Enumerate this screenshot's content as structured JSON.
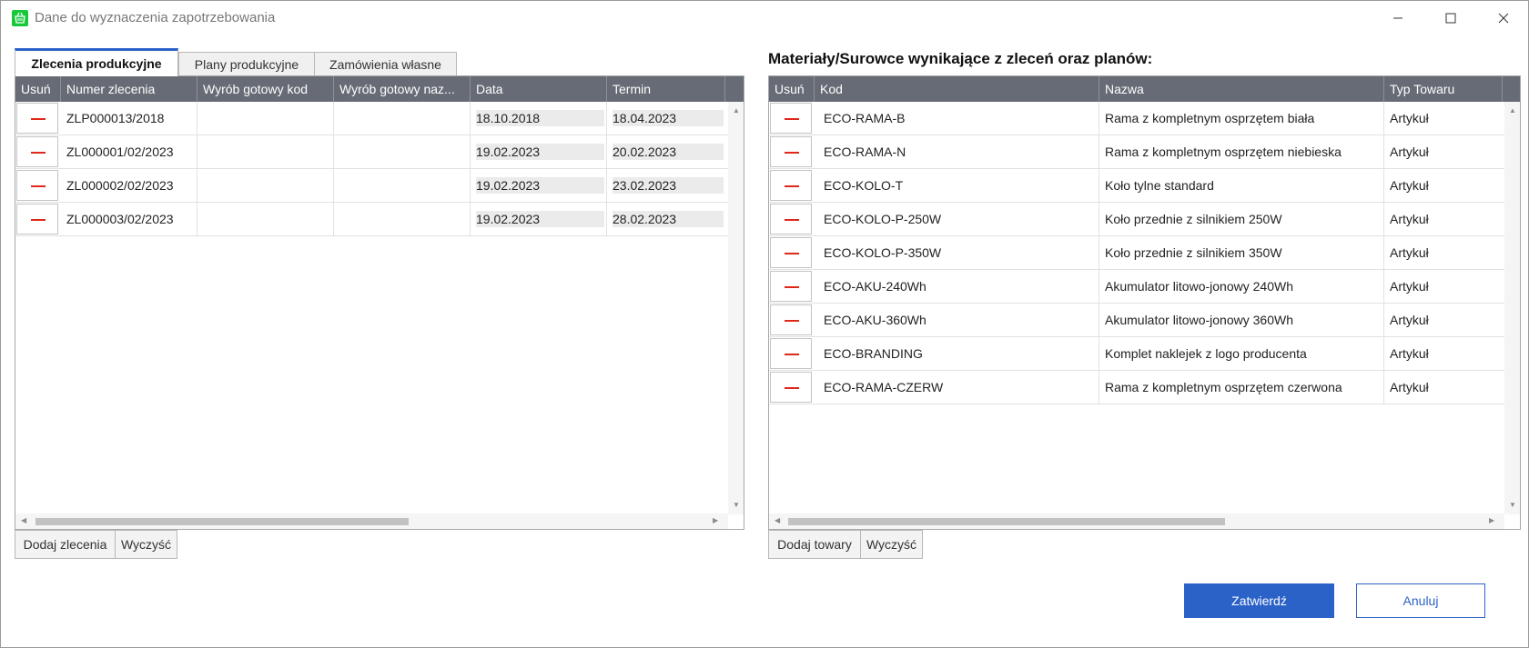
{
  "window": {
    "title": "Dane do wyznaczenia zapotrzebowania",
    "icon": "basket-icon",
    "controls": [
      "minimize-icon",
      "maximize-icon",
      "close-icon"
    ]
  },
  "left": {
    "tabs": [
      {
        "label": "Zlecenia produkcyjne",
        "active": true
      },
      {
        "label": "Plany produkcyjne",
        "active": false
      },
      {
        "label": "Zamówienia własne",
        "active": false
      }
    ],
    "columns": [
      "Usuń",
      "Numer zlecenia",
      "Wyrób gotowy kod",
      "Wyrób gotowy naz...",
      "Data",
      "Termin"
    ],
    "rows": [
      {
        "numer": "ZLP000013/2018",
        "kod": "",
        "nazwa": "",
        "data": "18.10.2018",
        "termin": "18.04.2023"
      },
      {
        "numer": "ZL000001/02/2023",
        "kod": "",
        "nazwa": "",
        "data": "19.02.2023",
        "termin": "20.02.2023"
      },
      {
        "numer": "ZL000002/02/2023",
        "kod": "",
        "nazwa": "",
        "data": "19.02.2023",
        "termin": "23.02.2023"
      },
      {
        "numer": "ZL000003/02/2023",
        "kod": "",
        "nazwa": "",
        "data": "19.02.2023",
        "termin": "28.02.2023"
      }
    ],
    "add_button": "Dodaj zlecenia",
    "clear_button": "Wyczyść"
  },
  "right": {
    "title": "Materiały/Surowce wynikające z zleceń oraz planów:",
    "columns": [
      "Usuń",
      "Kod",
      "Nazwa",
      "Typ Towaru"
    ],
    "rows": [
      {
        "kod": "ECO-RAMA-B",
        "nazwa": "Rama z kompletnym osprzętem biała",
        "typ": "Artykuł"
      },
      {
        "kod": "ECO-RAMA-N",
        "nazwa": "Rama z kompletnym osprzętem niebieska",
        "typ": "Artykuł"
      },
      {
        "kod": "ECO-KOLO-T",
        "nazwa": "Koło tylne standard",
        "typ": "Artykuł"
      },
      {
        "kod": "ECO-KOLO-P-250W",
        "nazwa": "Koło przednie z silnikiem 250W",
        "typ": "Artykuł"
      },
      {
        "kod": "ECO-KOLO-P-350W",
        "nazwa": "Koło przednie z silnikiem 350W",
        "typ": "Artykuł"
      },
      {
        "kod": "ECO-AKU-240Wh",
        "nazwa": "Akumulator litowo-jonowy 240Wh",
        "typ": "Artykuł"
      },
      {
        "kod": "ECO-AKU-360Wh",
        "nazwa": "Akumulator litowo-jonowy 360Wh",
        "typ": "Artykuł"
      },
      {
        "kod": "ECO-BRANDING",
        "nazwa": "Komplet naklejek z logo producenta",
        "typ": "Artykuł"
      },
      {
        "kod": "ECO-RAMA-CZERW",
        "nazwa": "Rama z kompletnym osprzętem czerwona",
        "typ": "Artykuł"
      }
    ],
    "add_button": "Dodaj towary",
    "clear_button": "Wyczyść"
  },
  "footer": {
    "confirm": "Zatwierdź",
    "cancel": "Anuluj"
  },
  "colors": {
    "accent": "#2b62c8",
    "header_bg": "#676b75",
    "delete_red": "#e0281a",
    "app_icon": "#15c93a"
  }
}
